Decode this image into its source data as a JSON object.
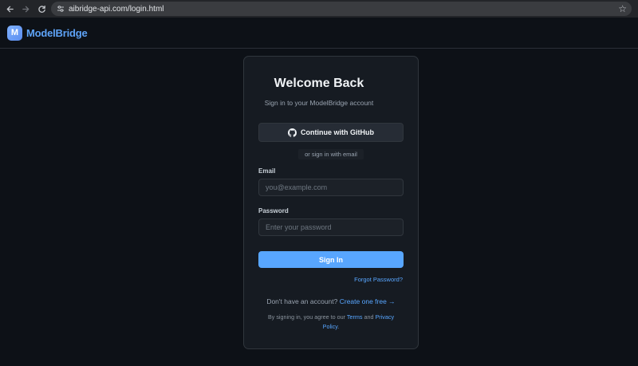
{
  "browser": {
    "url": "aibridge-api.com/login.html"
  },
  "header": {
    "logo_letter": "M",
    "brand": "ModelBridge"
  },
  "login": {
    "title": "Welcome Back",
    "subtitle": "Sign in to your ModelBridge account",
    "github_label": "Continue with GitHub",
    "divider": "or sign in with email",
    "email_label": "Email",
    "email_placeholder": "you@example.com",
    "email_value": "",
    "password_label": "Password",
    "password_placeholder": "Enter your password",
    "password_value": "",
    "submit_label": "Sign In",
    "forgot_label": "Forgot Password?",
    "signup_prompt": "Don't have an account?",
    "signup_link": "Create one free →",
    "terms_prefix": "By signing in, you agree to our",
    "terms_link": "Terms",
    "terms_and": "and",
    "privacy_link_1": "Privacy",
    "privacy_link_2": "Policy",
    "terms_suffix": "."
  },
  "colors": {
    "accent": "#58a6ff",
    "background": "#0d1117",
    "card": "#161b22"
  },
  "icons": {
    "back": "arrow-left-icon",
    "forward": "arrow-right-icon",
    "reload": "reload-icon",
    "site_settings": "tune-icon",
    "bookmark": "star-icon",
    "github": "github-icon"
  }
}
